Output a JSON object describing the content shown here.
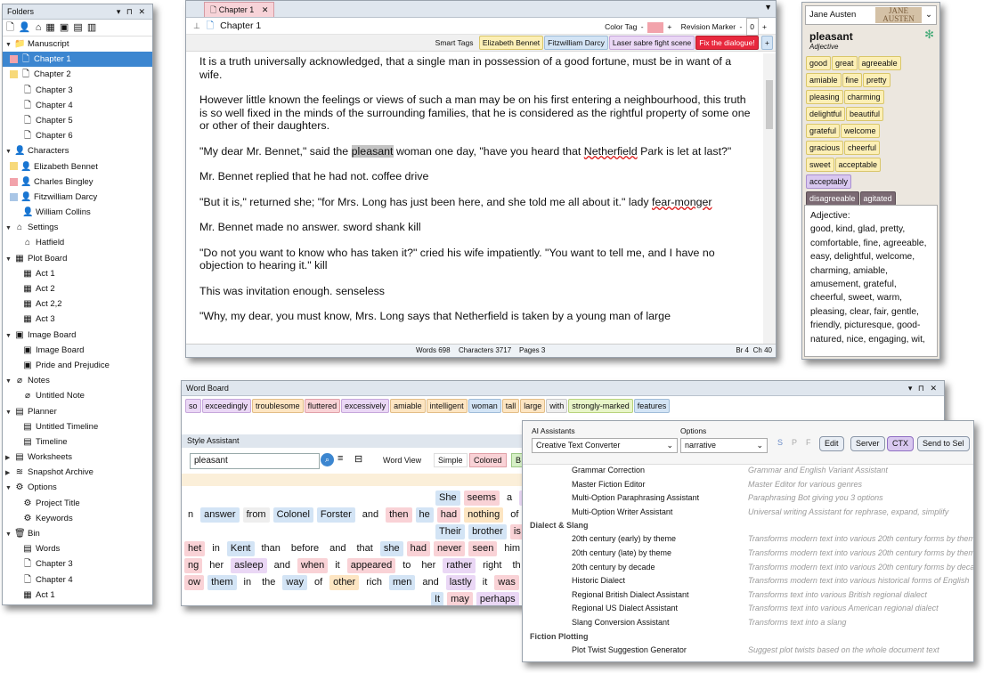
{
  "folders": {
    "title": "Folders",
    "items": [
      {
        "label": "Manuscript",
        "indent": 0,
        "caret": "▼",
        "icon": "📁",
        "icon_name": "folder-icon"
      },
      {
        "label": "Chapter 1",
        "indent": 1,
        "icon": "🗋",
        "icon_name": "document-icon",
        "swatch": "#f2a3ab",
        "selected": true
      },
      {
        "label": "Chapter 2",
        "indent": 1,
        "icon": "🗋",
        "icon_name": "document-icon",
        "swatch": "#f7d97a"
      },
      {
        "label": "Chapter 3",
        "indent": 1,
        "icon": "🗋",
        "icon_name": "document-icon"
      },
      {
        "label": "Chapter 4",
        "indent": 1,
        "icon": "🗋",
        "icon_name": "document-icon"
      },
      {
        "label": "Chapter 5",
        "indent": 1,
        "icon": "🗋",
        "icon_name": "document-icon"
      },
      {
        "label": "Chapter 6",
        "indent": 1,
        "icon": "🗋",
        "icon_name": "document-icon"
      },
      {
        "label": "Characters",
        "indent": 0,
        "caret": "▼",
        "icon": "👤",
        "icon_name": "people-icon"
      },
      {
        "label": "Elizabeth Bennet",
        "indent": 1,
        "icon": "👤",
        "icon_name": "person-icon",
        "swatch": "#f7d97a"
      },
      {
        "label": "Charles Bingley",
        "indent": 1,
        "icon": "👤",
        "icon_name": "person-icon",
        "swatch": "#f2a3ab"
      },
      {
        "label": "Fitzwilliam Darcy",
        "indent": 1,
        "icon": "👤",
        "icon_name": "person-icon",
        "swatch": "#a9c6e6"
      },
      {
        "label": "William Collins",
        "indent": 1,
        "icon": "👤",
        "icon_name": "person-icon"
      },
      {
        "label": "Settings",
        "indent": 0,
        "caret": "▼",
        "icon": "⌂",
        "icon_name": "home-icon"
      },
      {
        "label": "Hatfield",
        "indent": 1,
        "icon": "⌂",
        "icon_name": "home-icon"
      },
      {
        "label": "Plot Board",
        "indent": 0,
        "caret": "▼",
        "icon": "▦",
        "icon_name": "grid-icon"
      },
      {
        "label": "Act 1",
        "indent": 1,
        "icon": "▦",
        "icon_name": "grid-icon"
      },
      {
        "label": "Act 2",
        "indent": 1,
        "icon": "▦",
        "icon_name": "grid-icon"
      },
      {
        "label": "Act 2,2",
        "indent": 1,
        "icon": "▦",
        "icon_name": "grid-icon"
      },
      {
        "label": "Act 3",
        "indent": 1,
        "icon": "▦",
        "icon_name": "grid-icon"
      },
      {
        "label": "Image Board",
        "indent": 0,
        "caret": "▼",
        "icon": "▣",
        "icon_name": "image-icon"
      },
      {
        "label": "Image Board",
        "indent": 1,
        "icon": "▣",
        "icon_name": "image-icon"
      },
      {
        "label": "Pride and Prejudice",
        "indent": 1,
        "icon": "▣",
        "icon_name": "image-icon"
      },
      {
        "label": "Notes",
        "indent": 0,
        "caret": "▼",
        "icon": "⌀",
        "icon_name": "paperclip-icon"
      },
      {
        "label": "Untitled Note",
        "indent": 1,
        "icon": "⌀",
        "icon_name": "paperclip-icon"
      },
      {
        "label": "Planner",
        "indent": 0,
        "caret": "▼",
        "icon": "▤",
        "icon_name": "calendar-icon"
      },
      {
        "label": "Untitled Timeline",
        "indent": 1,
        "icon": "▤",
        "icon_name": "calendar-icon"
      },
      {
        "label": "Timeline",
        "indent": 1,
        "icon": "▤",
        "icon_name": "calendar-icon"
      },
      {
        "label": "Worksheets",
        "indent": 0,
        "caret": "▶",
        "icon": "▤",
        "icon_name": "worksheet-icon"
      },
      {
        "label": "Snapshot Archive",
        "indent": 0,
        "caret": "▶",
        "icon": "≋",
        "icon_name": "layers-icon"
      },
      {
        "label": "Options",
        "indent": 0,
        "caret": "▼",
        "icon": "⚙",
        "icon_name": "gear-icon"
      },
      {
        "label": "Project Title",
        "indent": 1,
        "icon": "⚙",
        "icon_name": "gear-icon"
      },
      {
        "label": "Keywords",
        "indent": 1,
        "icon": "⚙",
        "icon_name": "gear-icon"
      },
      {
        "label": "Bin",
        "indent": 0,
        "caret": "▼",
        "icon": "🗑",
        "icon_name": "trash-icon"
      },
      {
        "label": "Words",
        "indent": 1,
        "icon": "▤",
        "icon_name": "table-icon"
      },
      {
        "label": "Chapter 3",
        "indent": 1,
        "icon": "🗋",
        "icon_name": "document-icon"
      },
      {
        "label": "Chapter 4",
        "indent": 1,
        "icon": "🗋",
        "icon_name": "document-icon"
      },
      {
        "label": "Act 1",
        "indent": 1,
        "icon": "▦",
        "icon_name": "grid-icon"
      }
    ]
  },
  "editor": {
    "tab_label": "Chapter 1",
    "doc_title": "Chapter 1",
    "color_tag_label": "Color Tag",
    "color_tag_color": "#f2a3ab",
    "revision_label": "Revision Marker",
    "revision_value": "0",
    "smart_tags_label": "Smart Tags",
    "smart_tags": [
      {
        "label": "Elizabeth Bennet",
        "cls": "c-yel"
      },
      {
        "label": "Fitzwilliam Darcy",
        "cls": "c-blu"
      },
      {
        "label": "Laser sabre fight scene",
        "cls": "c-pur"
      },
      {
        "label": "Fix the dialogue!",
        "cls": "c-red"
      }
    ],
    "body": {
      "p1": "It is a truth universally acknowledged, that a single man in possession of a good fortune, must be in want of a wife.",
      "p2": "However little known the feelings or views of such a man may be on his first entering a neighbourhood, this truth is so well fixed in the minds of the surrounding families, that he is considered as the rightful property of some one or other of their daughters.",
      "p3a": "\"My dear Mr. Bennet,\" said the ",
      "p3_hl": "pleasant",
      "p3b": " woman one day, \"have you heard that ",
      "p3_sq": "Netherfield",
      "p3c": " Park is let at last?\"",
      "p4": "Mr. Bennet replied that he had not. coffee drive",
      "p5a": "\"But it is,\" returned she; \"for Mrs. Long has just been here, and she told me all about it.\" lady ",
      "p5_sq": "fear-monger",
      "p6": "Mr. Bennet made no answer.  sword shank kill",
      "p7": "\"Do not you want to know who has taken it?\" cried his wife impatiently. \"You want to tell me, and I have no objection to hearing it.\" kill",
      "p8": "This was invitation enough. senseless",
      "p9": "\"Why, my dear, you must know, Mrs. Long says that Netherfield is taken by a young man of large"
    },
    "status": {
      "words": "Words 698",
      "chars": "Characters 3717",
      "pages": "Pages 3",
      "br": "Br 4",
      "ch": "Ch 40"
    }
  },
  "thesaurus": {
    "source": "Jane Austen",
    "word": "pleasant",
    "pos": "Adjective",
    "tags": [
      {
        "label": "good",
        "cls": "c-yel"
      },
      {
        "label": "great",
        "cls": "c-yel"
      },
      {
        "label": "agreeable",
        "cls": "c-yel"
      },
      {
        "label": "amiable",
        "cls": "c-yel"
      },
      {
        "label": "fine",
        "cls": "c-yel"
      },
      {
        "label": "pretty",
        "cls": "c-yel"
      },
      {
        "label": "pleasing",
        "cls": "c-yel"
      },
      {
        "label": "charming",
        "cls": "c-yel"
      },
      {
        "label": "delightful",
        "cls": "c-yel"
      },
      {
        "label": "beautiful",
        "cls": "c-yel"
      },
      {
        "label": "grateful",
        "cls": "c-yel"
      },
      {
        "label": "welcome",
        "cls": "c-yel"
      },
      {
        "label": "gracious",
        "cls": "c-yel"
      },
      {
        "label": "cheerful",
        "cls": "c-yel"
      },
      {
        "label": "sweet",
        "cls": "c-yel"
      },
      {
        "label": "acceptable",
        "cls": "c-yel"
      },
      {
        "label": "acceptably",
        "cls": "c-lav"
      },
      {
        "label": "disagreeable",
        "cls": "c-dk"
      },
      {
        "label": "agitated",
        "cls": "c-dk"
      }
    ],
    "definition_heading": "Adjective:",
    "definition": "good, kind, glad, pretty, comfortable, fine, agreeable, easy, delightful, welcome, charming, amiable, amusement, grateful, cheerful, sweet, warm, pleasing, clear, fair, gentle, friendly, picturesque, good-natured, nice, engaging, wit,"
  },
  "word_board": {
    "title": "Word Board",
    "tags": [
      {
        "label": "so",
        "cls": "c-pur"
      },
      {
        "label": "exceedingly",
        "cls": "c-pur"
      },
      {
        "label": "troublesome",
        "cls": "c-org"
      },
      {
        "label": "fluttered",
        "cls": "c-pink"
      },
      {
        "label": "excessively",
        "cls": "c-pur"
      },
      {
        "label": "amiable",
        "cls": "c-org"
      },
      {
        "label": "intelligent",
        "cls": "c-org"
      },
      {
        "label": "woman",
        "cls": "c-blu"
      },
      {
        "label": "tall",
        "cls": "c-org"
      },
      {
        "label": "large",
        "cls": "c-org"
      },
      {
        "label": "with",
        "cls": "c-gray"
      },
      {
        "label": "strongly-marked",
        "cls": "c-grn"
      },
      {
        "label": "features",
        "cls": "c-blu"
      }
    ]
  },
  "style_assistant": {
    "title": "Style Assistant",
    "search_value": "pleasant",
    "word_view_label": "Word View",
    "simple_label": "Simple",
    "colored_label": "Colored",
    "rows": [
      [
        {
          "t": "She",
          "c": "c-blu"
        },
        {
          "t": "seems",
          "c": "c-pink"
        },
        {
          "t": "a",
          "c": ""
        },
        {
          "t": "v",
          "c": "c-pur"
        }
      ],
      [
        {
          "t": "n",
          "c": ""
        },
        {
          "t": "answer",
          "c": "c-blu"
        },
        {
          "t": "from",
          "c": "c-gray"
        },
        {
          "t": "Colonel",
          "c": "c-blu"
        },
        {
          "t": "Forster",
          "c": "c-blu"
        },
        {
          "t": "and",
          "c": ""
        },
        {
          "t": "then",
          "c": "c-pink"
        },
        {
          "t": "he",
          "c": "c-blu"
        },
        {
          "t": "had",
          "c": "c-pink"
        },
        {
          "t": "nothing",
          "c": "c-org"
        },
        {
          "t": "of",
          "c": ""
        }
      ],
      [
        {
          "t": "Their",
          "c": "c-blu"
        },
        {
          "t": "brother",
          "c": "c-blu"
        },
        {
          "t": "is",
          "c": "c-pink"
        }
      ],
      [
        {
          "t": "het",
          "c": "c-pink"
        },
        {
          "t": "in",
          "c": ""
        },
        {
          "t": "Kent",
          "c": "c-blu"
        },
        {
          "t": "than",
          "c": ""
        },
        {
          "t": "before",
          "c": ""
        },
        {
          "t": "and",
          "c": ""
        },
        {
          "t": "that",
          "c": ""
        },
        {
          "t": "she",
          "c": "c-blu"
        },
        {
          "t": "had",
          "c": "c-pink"
        },
        {
          "t": "never",
          "c": "c-pink"
        },
        {
          "t": "seen",
          "c": "c-pink"
        },
        {
          "t": "him",
          "c": ""
        }
      ],
      [
        {
          "t": "ng",
          "c": "c-pink"
        },
        {
          "t": "her",
          "c": ""
        },
        {
          "t": "asleep",
          "c": "c-pur"
        },
        {
          "t": "and",
          "c": ""
        },
        {
          "t": "when",
          "c": "c-pink"
        },
        {
          "t": "it",
          "c": ""
        },
        {
          "t": "appeared",
          "c": "c-pink"
        },
        {
          "t": "to",
          "c": ""
        },
        {
          "t": "her",
          "c": ""
        },
        {
          "t": "rather",
          "c": "c-pur"
        },
        {
          "t": "right",
          "c": ""
        },
        {
          "t": "th",
          "c": ""
        }
      ],
      [
        {
          "t": "ow",
          "c": "c-pink"
        },
        {
          "t": "them",
          "c": "c-blu"
        },
        {
          "t": "in",
          "c": ""
        },
        {
          "t": "the",
          "c": ""
        },
        {
          "t": "way",
          "c": "c-blu"
        },
        {
          "t": "of",
          "c": ""
        },
        {
          "t": "other",
          "c": "c-org"
        },
        {
          "t": "rich",
          "c": ""
        },
        {
          "t": "men",
          "c": "c-blu"
        },
        {
          "t": "and",
          "c": ""
        },
        {
          "t": "lastly",
          "c": "c-pur"
        },
        {
          "t": "it",
          "c": ""
        },
        {
          "t": "was",
          "c": "c-pink"
        }
      ],
      [
        {
          "t": "It",
          "c": "c-blu"
        },
        {
          "t": "may",
          "c": "c-pink"
        },
        {
          "t": "perhaps",
          "c": "c-pur"
        }
      ]
    ]
  },
  "ai_assistants": {
    "label": "AI Assistants",
    "options_label": "Options",
    "selected_assistant": "Creative Text Converter",
    "selected_option": "narrative",
    "sp_labels": [
      "S",
      "P",
      "F"
    ],
    "buttons": [
      "Edit",
      "Server",
      "CTX",
      "Send to Sel"
    ],
    "list": [
      {
        "type": "item",
        "name": "Grammar Correction",
        "desc": "Grammar and English Variant Assistant"
      },
      {
        "type": "item",
        "name": "Master Fiction Editor",
        "desc": "Master Editor for various genres"
      },
      {
        "type": "item",
        "name": "Multi-Option Paraphrasing Assistant",
        "desc": "Paraphrasing Bot giving you 3 options"
      },
      {
        "type": "item",
        "name": "Multi-Option Writer Assistant",
        "desc": "Universal writing Assistant for rephrase, expand, simplify"
      },
      {
        "type": "group",
        "name": "Dialect & Slang"
      },
      {
        "type": "item",
        "name": "20th century (early) by theme",
        "desc": "Transforms modern text into various 20th century forms by theme"
      },
      {
        "type": "item",
        "name": "20th century (late) by theme",
        "desc": "Transforms modern text into various 20th century forms by theme"
      },
      {
        "type": "item",
        "name": "20th century by decade",
        "desc": "Transforms modern text into various 20th century forms by decade"
      },
      {
        "type": "item",
        "name": "Historic Dialect",
        "desc": "Transforms modern text into various historical forms of English"
      },
      {
        "type": "item",
        "name": "Regional British Dialect Assistant",
        "desc": "Transforms text into various British regional dialect"
      },
      {
        "type": "item",
        "name": "Regional US Dialect Assistant",
        "desc": "Transforms text into various American regional dialect"
      },
      {
        "type": "item",
        "name": "Slang Conversion Assistant",
        "desc": "Transforms text into a slang"
      },
      {
        "type": "group",
        "name": "Fiction Plotting"
      },
      {
        "type": "item",
        "name": "Plot Twist Suggestion Generator",
        "desc": "Suggest plot twists based on the whole document text"
      }
    ]
  }
}
